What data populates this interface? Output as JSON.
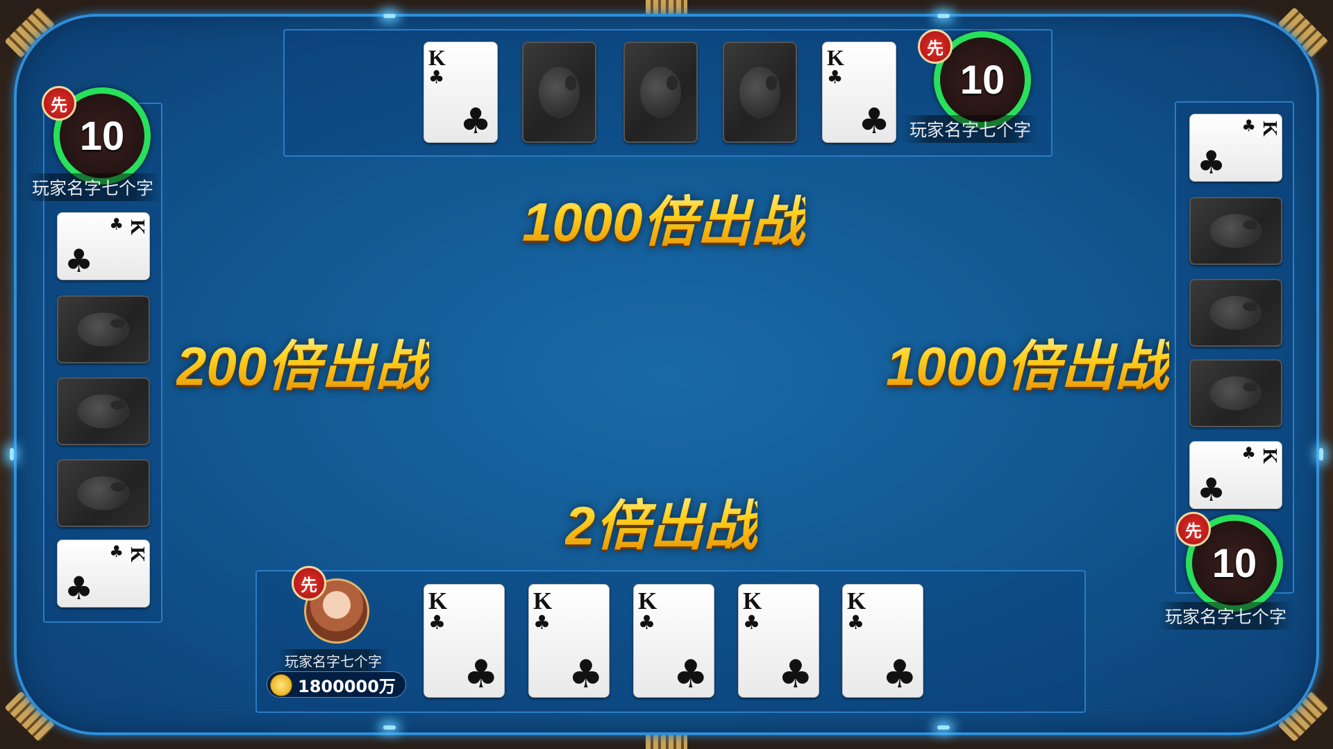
{
  "bets": {
    "top": "1000倍出战",
    "left": "200倍出战",
    "right": "1000倍出战",
    "bottom": "2倍出战"
  },
  "players": {
    "top": {
      "timer": "10",
      "first_badge": "先",
      "name": "玩家名字七个字"
    },
    "left": {
      "timer": "10",
      "first_badge": "先",
      "name": "玩家名字七个字"
    },
    "right": {
      "timer": "10",
      "first_badge": "先",
      "name": "玩家名字七个字"
    },
    "self": {
      "first_badge": "先",
      "name": "玩家名字七个字",
      "coins": "1800000万"
    }
  },
  "cards": {
    "rank": "K",
    "suit": "♣",
    "top_hand": [
      "face",
      "back",
      "back",
      "back",
      "face"
    ],
    "left_hand": [
      "face",
      "back",
      "back",
      "back",
      "face"
    ],
    "right_hand": [
      "face",
      "back",
      "back",
      "back",
      "face"
    ],
    "self_hand": [
      "face",
      "face",
      "face",
      "face",
      "face"
    ]
  },
  "icons": {
    "card_back": "whale-logo-icon",
    "coin": "gold-coin-icon"
  },
  "colors": {
    "felt": "#125993",
    "timer_ring": "#28e05a",
    "bet_text": "#ffd01e",
    "first_badge": "#c8201c"
  }
}
